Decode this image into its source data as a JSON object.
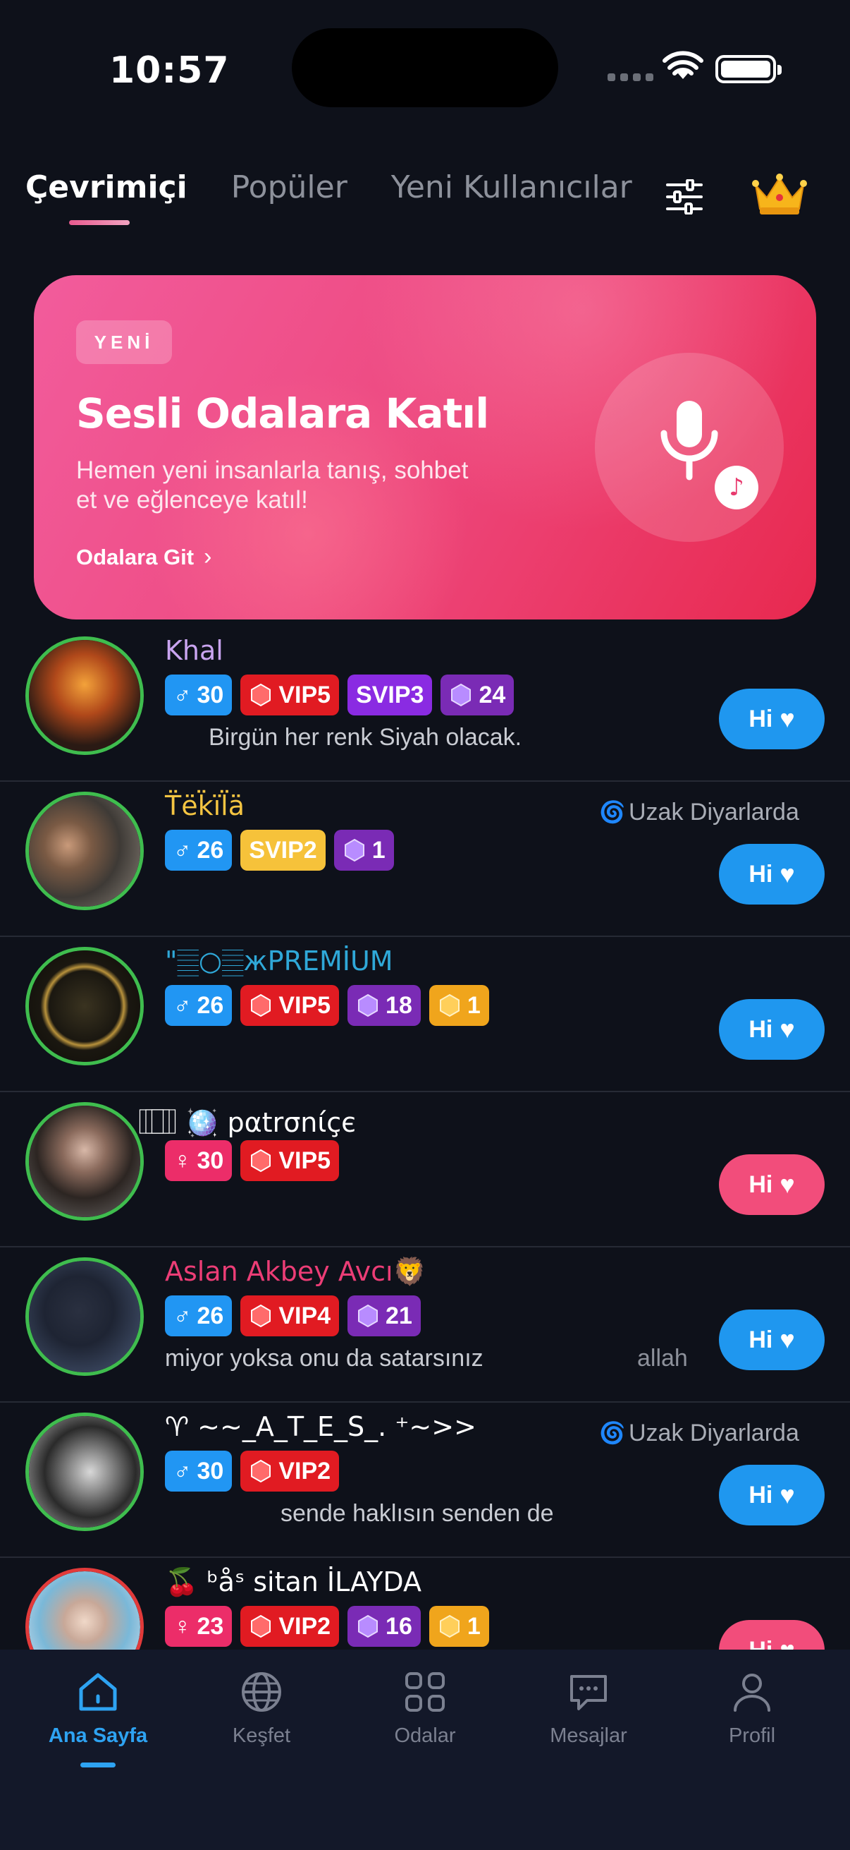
{
  "status_bar": {
    "time": "10:57"
  },
  "tabs": [
    {
      "label": "Çevrimiçi",
      "active": true
    },
    {
      "label": "Popüler",
      "active": false
    },
    {
      "label": "Yeni Kullanıcılar",
      "active": false
    }
  ],
  "icons": {
    "filter": "sliders-icon",
    "premium": "crown-icon"
  },
  "banner": {
    "badge": "YENİ",
    "title": "Sesli Odalara Katıl",
    "subtitle": "Hemen yeni insanlarla tanış, sohbet et ve eğlenceye katıl!",
    "link_label": "Odalara Git",
    "link_chevron": "›",
    "icon": "microphone-icon",
    "note_glyph": "♪"
  },
  "users": [
    {
      "name": "Khal",
      "name_color": "#c9a4f0",
      "gender_symbol": "♂",
      "age": "30",
      "vip": "VIP5",
      "svip": "SVIP3",
      "gem": "24",
      "status": "Birgün her renk Siyah olacak.",
      "hi_label": "Hi"
    },
    {
      "name": "T̈ëk̈ïl̈ä",
      "name_color": "#f5c542",
      "gender_symbol": "♂",
      "age": "26",
      "svip": "SVIP2",
      "gem": "1",
      "location": "Uzak Diyarlarda",
      "hi_label": "Hi"
    },
    {
      "name": "\"𝄛○𝄛жPREMİUM",
      "name_color": "#2fa8d8",
      "gender_symbol": "♂",
      "age": "26",
      "vip": "VIP5",
      "gem": "18",
      "gold": "1",
      "hi_label": "Hi"
    },
    {
      "name": "⃞ ⃞ ⃞ 🪩 pαtrσnίçє",
      "name_color": "#ffffff",
      "gender_symbol": "♀",
      "age": "30",
      "vip": "VIP5",
      "hi_label": "Hi"
    },
    {
      "name": "Aslan Akbey Avcı🦁",
      "name_color": "#ec3d76",
      "gender_symbol": "♂",
      "age": "26",
      "vip": "VIP4",
      "gem": "21",
      "status": "miyor yoksa onu da satarsınız",
      "status_tail": "allah",
      "hi_label": "Hi"
    },
    {
      "name": "♈ ~~_A_T_E_S_.   ⁺~>>",
      "name_color": "#ffffff",
      "gender_symbol": "♂",
      "age": "30",
      "vip": "VIP2",
      "location": "Uzak Diyarlarda",
      "status": "sende haklısın senden de",
      "hi_label": "Hi"
    },
    {
      "name": "🍒 ᵇåˢ sitan İLAYDA",
      "name_color": "#ffffff",
      "gender_symbol": "♀",
      "age": "23",
      "vip": "VIP2",
      "gem": "16",
      "gold": "1",
      "hi_label": "Hi"
    }
  ],
  "bottom_nav": [
    {
      "label": "Ana Sayfa",
      "icon": "home-icon",
      "active": true
    },
    {
      "label": "Keşfet",
      "icon": "globe-icon",
      "active": false
    },
    {
      "label": "Odalar",
      "icon": "grid-icon",
      "active": false
    },
    {
      "label": "Mesajlar",
      "icon": "chat-icon",
      "active": false
    },
    {
      "label": "Profil",
      "icon": "user-icon",
      "active": false
    }
  ]
}
